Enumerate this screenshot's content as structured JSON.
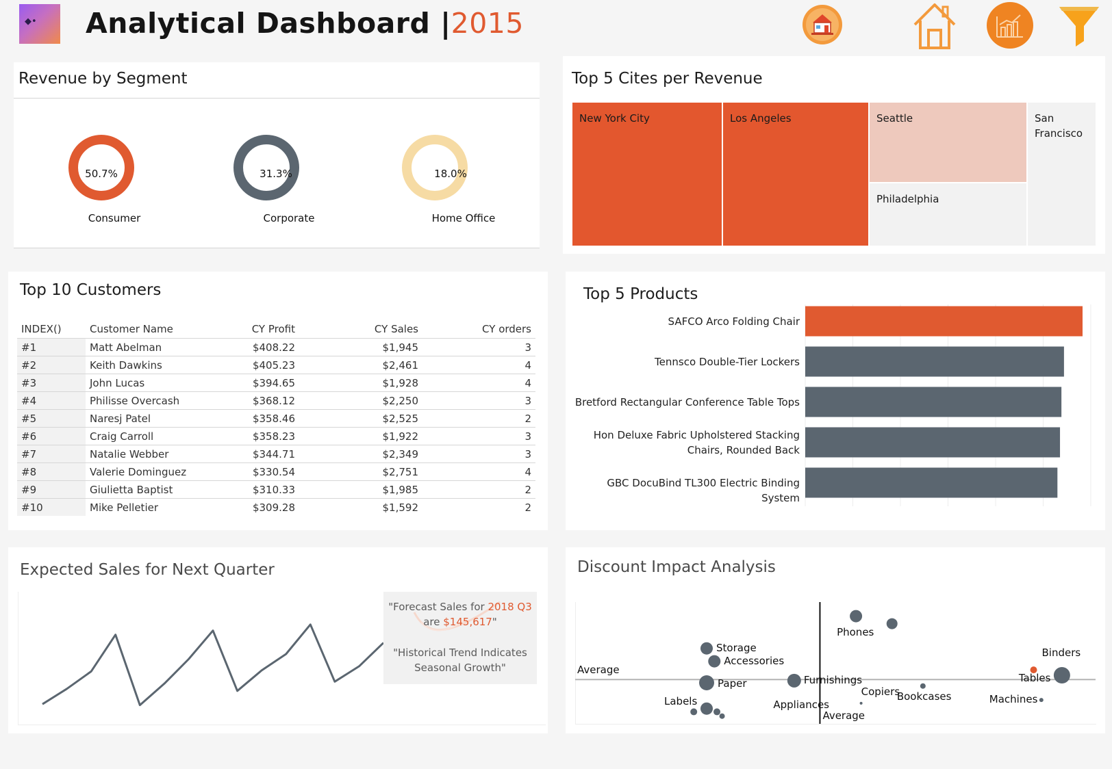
{
  "header": {
    "title": "Analytical Dashboard |",
    "year": "2015",
    "icons": [
      "store-icon",
      "home-icon",
      "chart-icon",
      "filter-icon"
    ],
    "accent_color": "#e05a30"
  },
  "segments": {
    "title": "Revenue by Segment",
    "items": [
      {
        "label": "Consumer",
        "value": "50.7%",
        "pct": 50.7,
        "color": "#e05a30"
      },
      {
        "label": "Corporate",
        "value": "31.3%",
        "pct": 31.3,
        "color": "#5b6670"
      },
      {
        "label": "Home Office",
        "value": "18.0%",
        "pct": 18.0,
        "color": "#f6dba4"
      }
    ]
  },
  "cities": {
    "title": "Top 5 Cites per Revenue",
    "tiles": [
      "New York City",
      "Los Angeles",
      "Seattle",
      "Philadelphia",
      "San Francisco"
    ]
  },
  "customers": {
    "title": "Top 10 Customers",
    "columns": [
      "INDEX()",
      "Customer Name",
      "CY Profit",
      "CY Sales",
      "CY orders"
    ],
    "rows": [
      [
        "#1",
        "Matt Abelman",
        "$408.22",
        "$1,945",
        "3"
      ],
      [
        "#2",
        "Keith Dawkins",
        "$405.23",
        "$2,461",
        "4"
      ],
      [
        "#3",
        "John Lucas",
        "$394.65",
        "$1,928",
        "4"
      ],
      [
        "#4",
        "Philisse Overcash",
        "$368.12",
        "$2,250",
        "3"
      ],
      [
        "#5",
        "Naresj Patel",
        "$358.46",
        "$2,525",
        "2"
      ],
      [
        "#6",
        "Craig Carroll",
        "$358.23",
        "$1,922",
        "3"
      ],
      [
        "#7",
        "Natalie Webber",
        "$344.71",
        "$2,349",
        "3"
      ],
      [
        "#8",
        "Valerie Dominguez",
        "$330.54",
        "$2,751",
        "4"
      ],
      [
        "#9",
        "Giulietta Baptist",
        "$310.33",
        "$1,985",
        "2"
      ],
      [
        "#10",
        "Mike Pelletier",
        "$309.28",
        "$1,592",
        "2"
      ]
    ]
  },
  "products": {
    "title": "Top 5 Products"
  },
  "forecast": {
    "title": "Expected Sales for Next Quarter",
    "callout": {
      "line1a": "\"Forecast Sales for ",
      "line1b": "2018 Q3",
      "line2a": "are ",
      "line2b": "$145,617",
      "line2c": "\"",
      "line3": "\"Historical Trend Indicates",
      "line4": "Seasonal Growth\""
    }
  },
  "discount": {
    "title": "Discount Impact Analysis"
  },
  "chart_data": [
    {
      "type": "bar",
      "orientation": "horizontal",
      "categories": [
        "SAFCO Arco Folding Chair",
        "Tennsco Double-Tier Lockers",
        "Bretford Rectangular Conference Table Tops",
        "Hon Deluxe Fabric Upholstered Stacking Chairs, Rounded Back",
        "GBC DocuBind TL300 Electric Binding System"
      ],
      "values": [
        100,
        93.5,
        92.6,
        92.1,
        91.2
      ],
      "colors": [
        "#e05a30",
        "#5b6670",
        "#5b6670",
        "#5b6670",
        "#5b6670"
      ],
      "xlim": [
        0,
        100
      ],
      "grid": true
    },
    {
      "type": "line",
      "x": [
        1,
        2,
        3,
        4,
        5,
        6,
        7,
        8,
        9,
        10,
        11,
        12,
        13,
        14,
        15
      ],
      "values": [
        20,
        35,
        52,
        88,
        19,
        40,
        64,
        92,
        33,
        53,
        69,
        98,
        42,
        57,
        80
      ],
      "color": "#5b6670",
      "ylim": [
        0,
        130
      ]
    },
    {
      "type": "scatter",
      "reference_lines": {
        "x_label": "Average",
        "y_label": "Average"
      },
      "points": [
        {
          "label": "Phones",
          "x": 54,
          "y": 92,
          "size": 9,
          "color": "#5b6670"
        },
        {
          "label": "",
          "x": 61,
          "y": 85,
          "size": 8,
          "color": "#5b6670"
        },
        {
          "label": "Storage",
          "x": 25,
          "y": 62,
          "size": 9,
          "color": "#5b6670"
        },
        {
          "label": "Accessories",
          "x": 26.5,
          "y": 50,
          "size": 9,
          "color": "#5b6670"
        },
        {
          "label": "Furnishings",
          "x": 42,
          "y": 32,
          "size": 10,
          "color": "#5b6670"
        },
        {
          "label": "Paper",
          "x": 25,
          "y": 30,
          "size": 11,
          "color": "#5b6670"
        },
        {
          "label": "Labels",
          "x": 25,
          "y": 6,
          "size": 9,
          "color": "#5b6670"
        },
        {
          "label": "",
          "x": 27,
          "y": 3,
          "size": 5,
          "color": "#5b6670"
        },
        {
          "label": "",
          "x": 22.5,
          "y": 3,
          "size": 5,
          "color": "#5b6670"
        },
        {
          "label": "",
          "x": 28,
          "y": -1,
          "size": 4,
          "color": "#5b6670"
        },
        {
          "label": "Appliances",
          "x": 43,
          "y": 18,
          "size": 0,
          "color": "#5b6670"
        },
        {
          "label": "Copiers",
          "x": 55,
          "y": 11,
          "size": 2,
          "color": "#5b6670"
        },
        {
          "label": "Bookcases",
          "x": 67,
          "y": 27,
          "size": 4,
          "color": "#5b6670"
        },
        {
          "label": "Binders",
          "x": 88.5,
          "y": 42,
          "size": 5,
          "color": "#e05a30"
        },
        {
          "label": "Tables",
          "x": 94,
          "y": 37,
          "size": 12,
          "color": "#5b6670"
        },
        {
          "label": "Machines",
          "x": 90,
          "y": 14,
          "size": 3,
          "color": "#5b6670"
        }
      ],
      "xlim": [
        0,
        100
      ],
      "ylim": [
        -5,
        100
      ],
      "avg_x": 47,
      "avg_y": 33
    }
  ]
}
